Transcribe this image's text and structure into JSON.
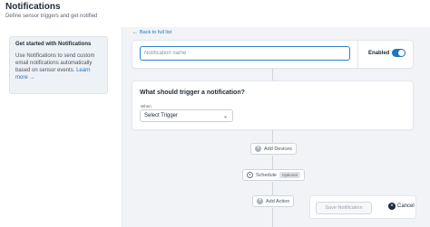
{
  "header": {
    "title": "Notifications",
    "subtitle": "Define sensor triggers and get notified"
  },
  "sidebar": {
    "info_title": "Get started with Notifications",
    "info_text": "Use Notifications to send custom email notifications automatically based on sensor events.",
    "learn_more": "Learn more →"
  },
  "back_link": "Back to full list",
  "name_card": {
    "placeholder": "Notification name",
    "value": "",
    "enabled_label": "Enabled",
    "enabled": true
  },
  "trigger_card": {
    "question": "What should trigger a notification?",
    "when_label": "When",
    "select_value": "Select Trigger"
  },
  "flow": {
    "add_devices": "Add Devices",
    "schedule": "Schedule",
    "schedule_badge": "Optional",
    "add_action": "Add Action"
  },
  "footer": {
    "save_label": "Save Notification",
    "cancel_label": "Cancel"
  },
  "colors": {
    "accent": "#1d73c5",
    "background": "#f1f3f6"
  }
}
